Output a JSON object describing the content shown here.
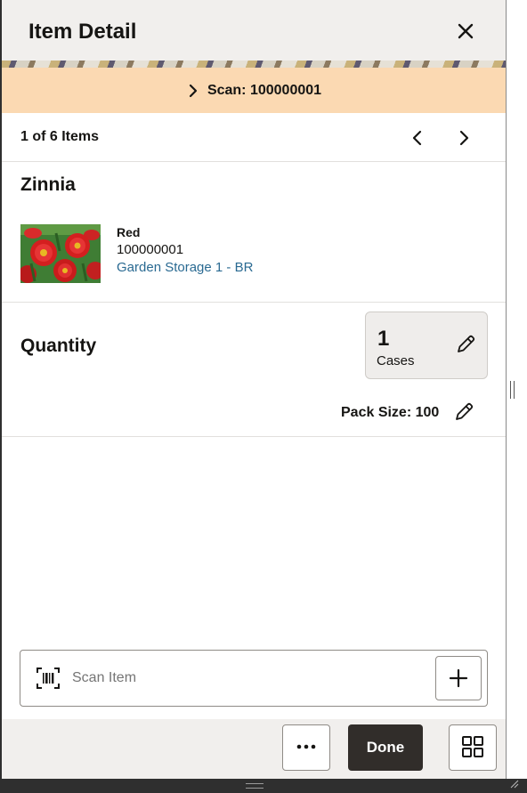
{
  "header": {
    "title": "Item Detail",
    "close_icon": "close-icon"
  },
  "scan_banner": {
    "label": "Scan: 100000001",
    "icon": "chevron-right-icon",
    "background": "#fbd9b2"
  },
  "navigation": {
    "count": "1 of 6 Items",
    "prev_icon": "chevron-left-icon",
    "next_icon": "chevron-right-icon"
  },
  "item": {
    "name": "Zinnia",
    "variant": "Red",
    "code": "100000001",
    "location": "Garden Storage 1 - BR"
  },
  "quantity": {
    "label": "Quantity",
    "value": "1",
    "unit": "Cases",
    "pack_size": "Pack Size: 100",
    "edit_icon": "pencil-icon"
  },
  "scan_item": {
    "placeholder": "Scan Item",
    "barcode_icon": "barcode-scan-icon",
    "add_icon": "plus-icon"
  },
  "footer": {
    "more_icon": "more-icon",
    "done_label": "Done",
    "grid_icon": "grid-icon",
    "done_color": "#312d2a"
  }
}
